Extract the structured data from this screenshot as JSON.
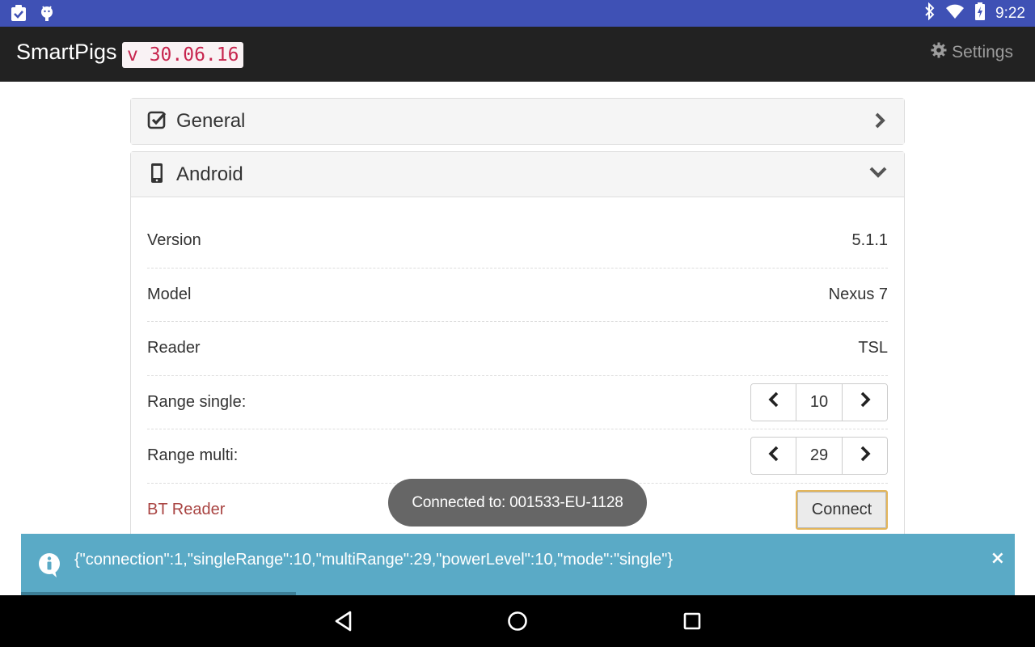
{
  "status_bar": {
    "left_icons": [
      "clipboard-check-icon",
      "android-debug-icon"
    ],
    "right_icons": [
      "bluetooth-icon",
      "wifi-icon",
      "battery-charging-icon"
    ],
    "time": "9:22"
  },
  "app_bar": {
    "title": "SmartPigs",
    "version": "v 30.06.16",
    "settings_label": "Settings"
  },
  "panels": {
    "general": {
      "title": "General",
      "icon": "checkbox-checked-icon",
      "expanded": false
    },
    "android": {
      "title": "Android",
      "icon": "mobile-phone-icon",
      "expanded": true,
      "rows": [
        {
          "label": "Version",
          "value": "5.1.1"
        },
        {
          "label": "Model",
          "value": "Nexus 7"
        },
        {
          "label": "Reader",
          "value": "TSL"
        },
        {
          "label": "Range single:",
          "value": "10"
        },
        {
          "label": "Range multi:",
          "value": "29"
        },
        {
          "label": "BT Reader",
          "button": "Connect"
        }
      ]
    }
  },
  "toast": {
    "text": "Connected to: 001533-EU-1128"
  },
  "notification": {
    "text": "{\"connection\":1,\"singleRange\":10,\"multiRange\":29,\"powerLevel\":10,\"mode\":\"single\"}",
    "close": "×",
    "progress_fraction": 0.277
  },
  "colors": {
    "status_bar": "#3f51b5",
    "app_bar": "#222222",
    "version_text": "#c7254e",
    "bt_reader_label": "#a94442",
    "notification_bg": "#5aaac6",
    "toast_bg": "#666666"
  }
}
